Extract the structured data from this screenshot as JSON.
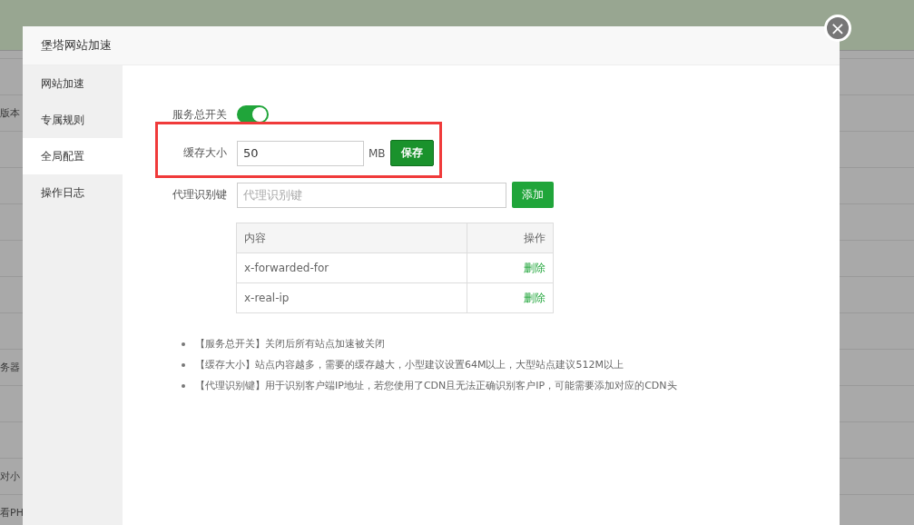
{
  "background_page": {
    "fragments": [
      "版本",
      "务器",
      "对小",
      "看PH"
    ]
  },
  "dialog": {
    "title": "堡塔网站加速",
    "close": "×",
    "sidebar": {
      "items": [
        {
          "label": "网站加速",
          "selected": false
        },
        {
          "label": "专属规则",
          "selected": false
        },
        {
          "label": "全局配置",
          "selected": true
        },
        {
          "label": "操作日志",
          "selected": false
        }
      ]
    },
    "form": {
      "service_switch": {
        "label": "服务总开关",
        "on": true
      },
      "cache_size": {
        "label": "缓存大小",
        "value": "50",
        "unit": "MB",
        "button": "保存",
        "highlighted": true
      },
      "proxy_key": {
        "label": "代理识别键",
        "placeholder": "代理识别键",
        "button": "添加"
      },
      "table": {
        "columns": [
          "内容",
          "操作"
        ],
        "rows": [
          {
            "content": "x-forwarded-for",
            "action": "删除"
          },
          {
            "content": "x-real-ip",
            "action": "删除"
          }
        ]
      }
    },
    "notes": [
      "【服务总开关】关闭后所有站点加速被关闭",
      "【缓存大小】站点内容越多，需要的缓存越大，小型建议设置64M以上，大型站点建议512M以上",
      "【代理识别键】用于识别客户端IP地址，若您使用了CDN且无法正确识别客户IP，可能需要添加对应的CDN头"
    ]
  }
}
